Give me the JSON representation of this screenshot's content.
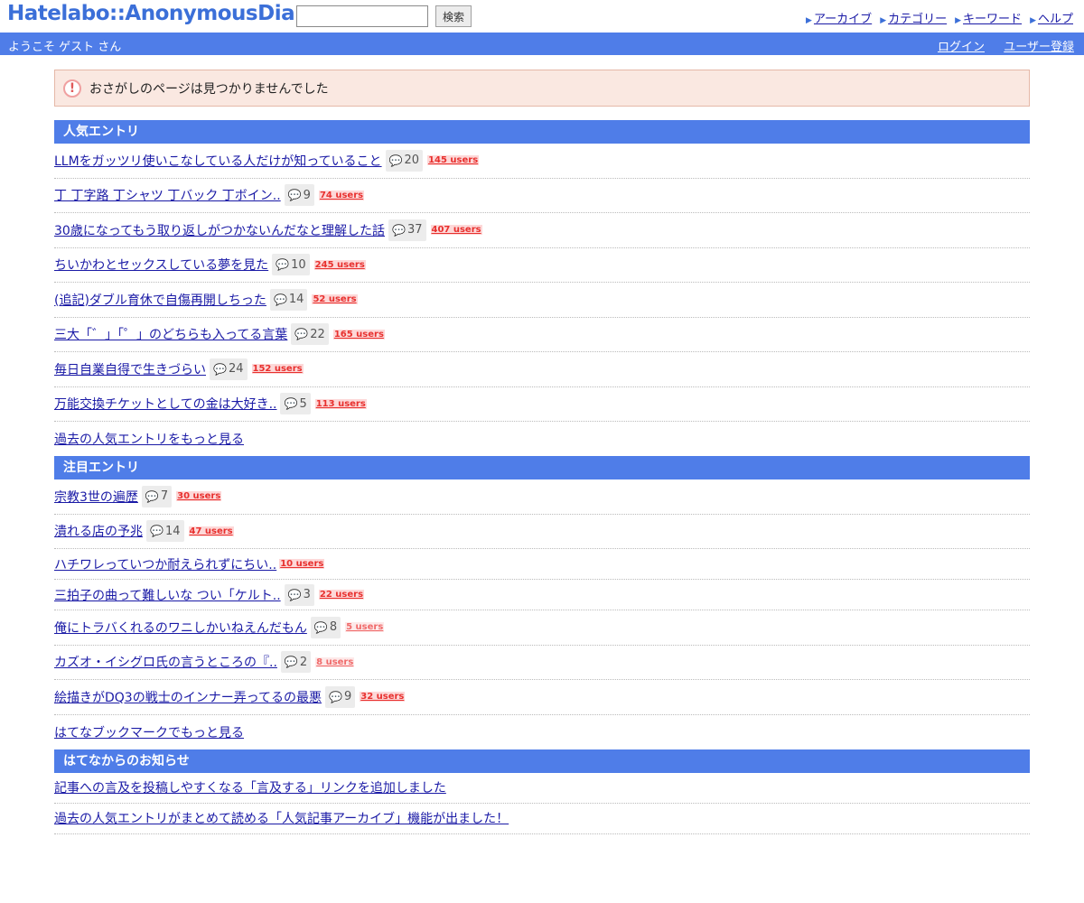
{
  "header": {
    "logo": "Hatelabo::AnonymousDiary",
    "search_placeholder": "",
    "search_button": "検索",
    "nav": [
      {
        "label": "アーカイブ"
      },
      {
        "label": "カテゴリー"
      },
      {
        "label": "キーワード"
      },
      {
        "label": "ヘルプ"
      }
    ]
  },
  "subbar": {
    "welcome": "ようこそ ゲスト さん",
    "login": "ログイン",
    "register": "ユーザー登録"
  },
  "notice_box": {
    "icon": "exclamation-icon",
    "message": "おさがしのページは見つかりませんでした"
  },
  "popular": {
    "heading": "人気エントリ",
    "entries": [
      {
        "title": "LLMをガッツリ使いこなしている人だけが知っていること",
        "comments": "20",
        "users": "145 users"
      },
      {
        "title": "丁 丁字路 丁シャツ 丁バック 丁ボイン..",
        "comments": "9",
        "users": "74 users"
      },
      {
        "title": "30歳になってもう取り返しがつかないんだなと理解した話",
        "comments": "37",
        "users": "407 users"
      },
      {
        "title": "ちいかわとセックスしている夢を見た",
        "comments": "10",
        "users": "245 users"
      },
      {
        "title": "(追記)ダブル育休で自傷再開しちった",
        "comments": "14",
        "users": "52 users"
      },
      {
        "title": "三大「゛」「゜」のどちらも入ってる言葉",
        "comments": "22",
        "users": "165 users"
      },
      {
        "title": "毎日自業自得で生きづらい",
        "comments": "24",
        "users": "152 users"
      },
      {
        "title": "万能交換チケットとしての金は大好き..",
        "comments": "5",
        "users": "113 users"
      }
    ],
    "more": "過去の人気エントリをもっと見る"
  },
  "noted": {
    "heading": "注目エントリ",
    "entries": [
      {
        "title": "宗教3世の遍歴",
        "comments": "7",
        "users": "30 users"
      },
      {
        "title": "潰れる店の予兆",
        "comments": "14",
        "users": "47 users"
      },
      {
        "title": "ハチワレっていつか耐えられずにちい..",
        "comments": "",
        "users": "10 users"
      },
      {
        "title": "三拍子の曲って難しいな つい「ケルト..",
        "comments": "3",
        "users": "22 users"
      },
      {
        "title": "俺にトラバくれるのワニしかいねえんだもん",
        "comments": "8",
        "users": "5 users"
      },
      {
        "title": "カズオ・イシグロ氏の言うところの『..",
        "comments": "2",
        "users": "8 users"
      },
      {
        "title": "絵描きがDQ3の戦士のインナー弄ってるの最悪",
        "comments": "9",
        "users": "32 users"
      }
    ],
    "more": "はてなブックマークでもっと見る"
  },
  "announcements": {
    "heading": "はてなからのお知らせ",
    "entries": [
      {
        "title": "記事への言及を投稿しやすくなる「言及する」リンクを追加しました"
      },
      {
        "title": "過去の人気エントリがまとめて読める「人気記事アーカイブ」機能が出ました！"
      }
    ]
  },
  "colors": {
    "accent": "#4f7de8",
    "link": "#1a1aa6",
    "users_badge": "#e8302e",
    "notice_bg": "#fae8e1"
  }
}
